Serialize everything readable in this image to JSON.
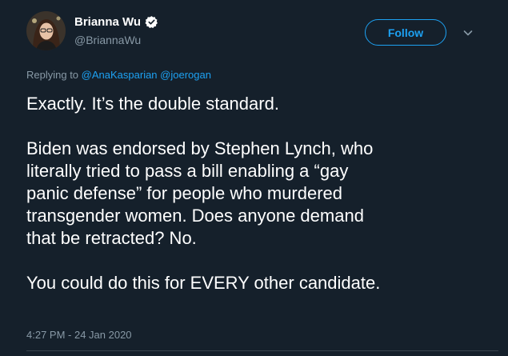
{
  "author": {
    "display_name": "Brianna Wu",
    "handle": "@BriannaWu",
    "verified": true
  },
  "actions": {
    "follow_label": "Follow",
    "more_icon": "chevron-down-icon"
  },
  "reply": {
    "prefix": "Replying to",
    "mentions": [
      "@AnaKasparian",
      "@joerogan"
    ]
  },
  "tweet": {
    "paragraphs": [
      "Exactly. It’s the double standard.",
      "Biden was endorsed by Stephen Lynch, who\nliterally tried to pass a bill enabling a “gay\npanic defense” for people who murdered\ntransgender women. Does anyone demand\nthat be retracted? No.",
      "You could do this for EVERY other candidate."
    ],
    "timestamp": "4:27 PM - 24 Jan 2020"
  },
  "colors": {
    "background": "#15202b",
    "accent": "#1da1f2",
    "secondary_text": "#8899a6",
    "primary_text": "#ffffff",
    "divider": "#38444d"
  }
}
